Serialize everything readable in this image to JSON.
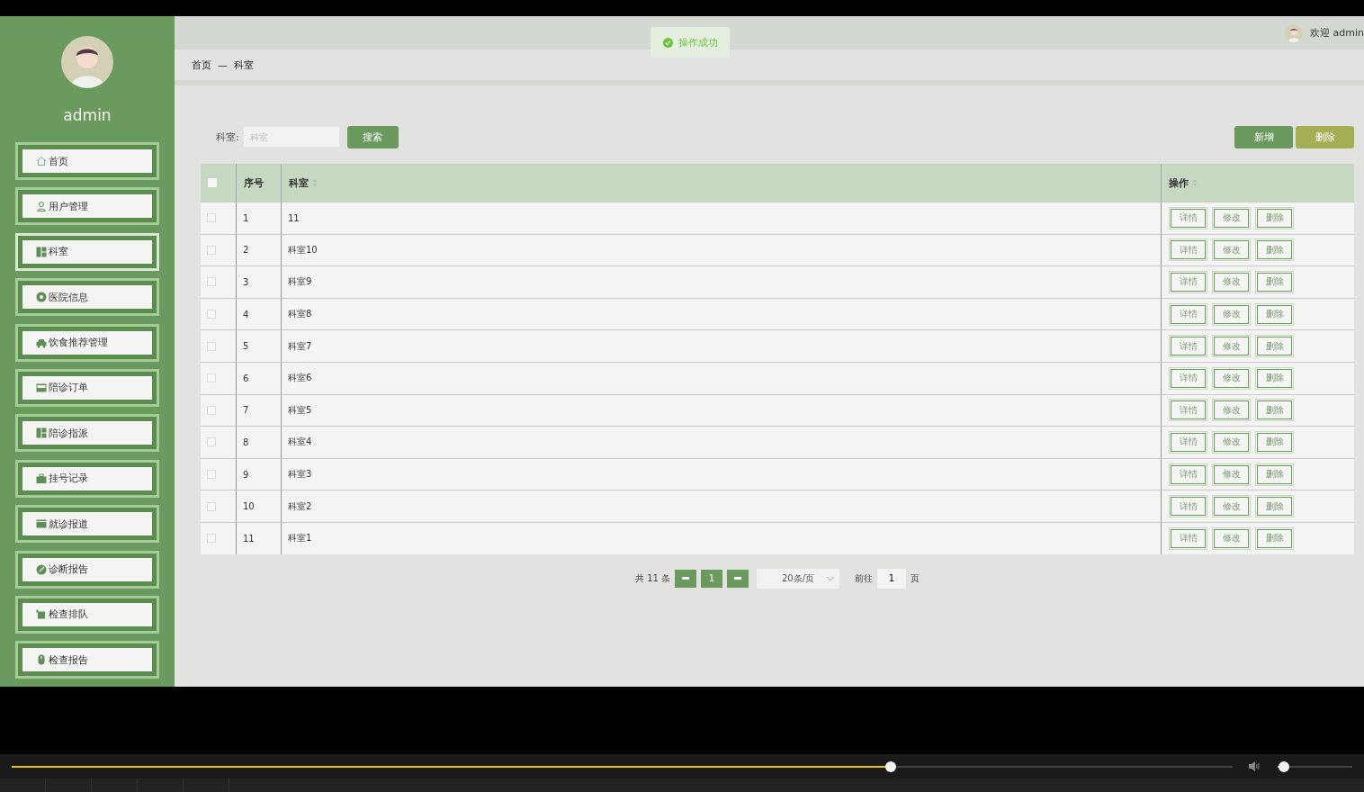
{
  "sidebar": {
    "username": "admin",
    "items": [
      {
        "label": "首页",
        "selected": false
      },
      {
        "label": "用户管理",
        "selected": false
      },
      {
        "label": "科室",
        "selected": true
      },
      {
        "label": "医院信息",
        "selected": false
      },
      {
        "label": "饮食推荐管理",
        "selected": false
      },
      {
        "label": "陪诊订单",
        "selected": false
      },
      {
        "label": "陪诊指派",
        "selected": false
      },
      {
        "label": "挂号记录",
        "selected": false
      },
      {
        "label": "就诊报道",
        "selected": false
      },
      {
        "label": "诊断报告",
        "selected": false
      },
      {
        "label": "检查排队",
        "selected": false
      },
      {
        "label": "检查报告",
        "selected": false
      }
    ]
  },
  "header": {
    "welcome": "欢迎 admin"
  },
  "toast": {
    "message": "操作成功"
  },
  "breadcrumb": [
    "首页",
    "科室"
  ],
  "breadcrumb_separator": "—",
  "search": {
    "label": "科室:",
    "placeholder": "科室",
    "button": "搜索"
  },
  "actions": [
    "新增",
    "删除"
  ],
  "table": {
    "select_all": {
      "checked": false
    },
    "columns": [
      "序号",
      "科室",
      "操作"
    ],
    "rows": [
      {
        "index": "1",
        "name": "11",
        "checked": false,
        "actions": [
          "详情",
          "修改",
          "删除"
        ]
      },
      {
        "index": "2",
        "name": "科室10",
        "checked": false,
        "actions": [
          "详情",
          "修改",
          "删除"
        ]
      },
      {
        "index": "3",
        "name": "科室9",
        "checked": false,
        "actions": [
          "详情",
          "修改",
          "删除"
        ]
      },
      {
        "index": "4",
        "name": "科室8",
        "checked": false,
        "actions": [
          "详情",
          "修改",
          "删除"
        ]
      },
      {
        "index": "5",
        "name": "科室7",
        "checked": false,
        "actions": [
          "详情",
          "修改",
          "删除"
        ]
      },
      {
        "index": "6",
        "name": "科室6",
        "checked": false,
        "actions": [
          "详情",
          "修改",
          "删除"
        ]
      },
      {
        "index": "7",
        "name": "科室5",
        "checked": false,
        "actions": [
          "详情",
          "修改",
          "删除"
        ]
      },
      {
        "index": "8",
        "name": "科室4",
        "checked": false,
        "actions": [
          "详情",
          "修改",
          "删除"
        ]
      },
      {
        "index": "9",
        "name": "科室3",
        "checked": false,
        "actions": [
          "详情",
          "修改",
          "删除"
        ]
      },
      {
        "index": "10",
        "name": "科室2",
        "checked": false,
        "actions": [
          "详情",
          "修改",
          "删除"
        ]
      },
      {
        "index": "11",
        "name": "科室1",
        "checked": false,
        "actions": [
          "详情",
          "修改",
          "删除"
        ]
      }
    ]
  },
  "pagination": {
    "total": "共 11 条",
    "current": "1",
    "page_size": "20条/页",
    "goto_label": "前往",
    "goto_value": "1",
    "page_unit": "页"
  },
  "player": {
    "progress": {
      "level": 0.72
    },
    "volume": {
      "level": 0.08
    }
  }
}
